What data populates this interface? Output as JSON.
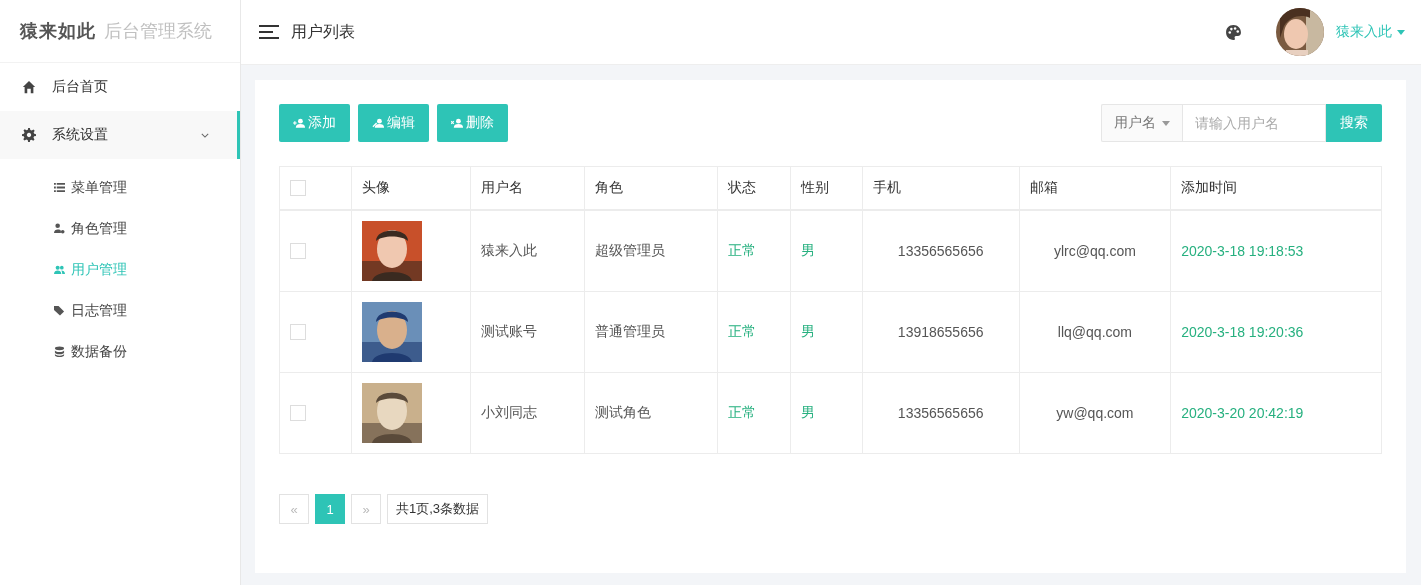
{
  "brand": {
    "logo": "猿来如此",
    "subtitle": "后台管理系统"
  },
  "header": {
    "page_title": "用户列表",
    "user_name": "猿来入此"
  },
  "sidebar": {
    "items": [
      {
        "label": "后台首页",
        "selected": false
      },
      {
        "label": "系统设置",
        "selected": true,
        "expanded": true,
        "children": [
          {
            "label": "菜单管理",
            "selected": false
          },
          {
            "label": "角色管理",
            "selected": false
          },
          {
            "label": "用户管理",
            "selected": true
          },
          {
            "label": "日志管理",
            "selected": false
          },
          {
            "label": "数据备份",
            "selected": false
          }
        ]
      }
    ]
  },
  "toolbar": {
    "buttons": [
      {
        "label": "添加"
      },
      {
        "label": "编辑"
      },
      {
        "label": "删除"
      }
    ],
    "search": {
      "field": "用户名",
      "placeholder": "请输入用户名",
      "button": "搜索"
    }
  },
  "table": {
    "header_checked": false,
    "columns": [
      "头像",
      "用户名",
      "角色",
      "状态",
      "性别",
      "手机",
      "邮箱",
      "添加时间"
    ],
    "rows": [
      {
        "checked": false,
        "username": "猿来入此",
        "role": "超级管理员",
        "status": "正常",
        "gender": "男",
        "phone": "13356565656",
        "email": "ylrc@qq.com",
        "added": "2020-3-18 19:18:53"
      },
      {
        "checked": false,
        "username": "测试账号",
        "role": "普通管理员",
        "status": "正常",
        "gender": "男",
        "phone": "13918655656",
        "email": "llq@qq.com",
        "added": "2020-3-18 19:20:36"
      },
      {
        "checked": false,
        "username": "小刘同志",
        "role": "测试角色",
        "status": "正常",
        "gender": "男",
        "phone": "13356565656",
        "email": "yw@qq.com",
        "added": "2020-3-20 20:42:19"
      }
    ]
  },
  "pagination": {
    "prev": "«",
    "pages": [
      {
        "label": "1",
        "selected": true
      }
    ],
    "next": "»",
    "summary": "共1页,3条数据"
  }
}
